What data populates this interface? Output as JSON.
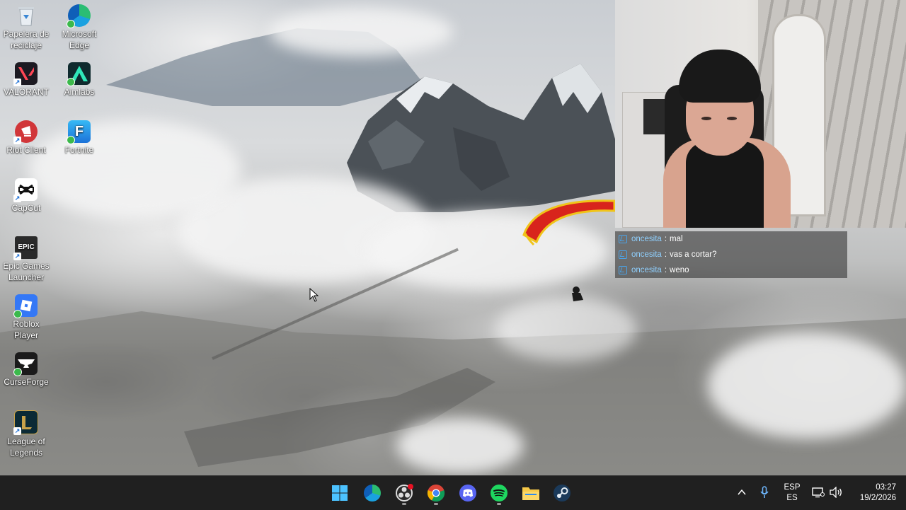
{
  "desktop": {
    "icons": [
      {
        "label": "Papelera de reciclaje",
        "icon": "recycle-bin-icon"
      },
      {
        "label": "Microsoft Edge",
        "icon": "edge-icon"
      },
      {
        "label": "VALORANT",
        "icon": "valorant-icon"
      },
      {
        "label": "Aimlabs",
        "icon": "aimlabs-icon"
      },
      {
        "label": "Riot Client",
        "icon": "riot-client-icon"
      },
      {
        "label": "Fortnite",
        "icon": "fortnite-icon"
      },
      {
        "label": "CapCut",
        "icon": "capcut-icon"
      },
      {
        "label": "Epic Games Launcher",
        "icon": "epic-games-icon",
        "glyph": "EPIC"
      },
      {
        "label": "Roblox Player",
        "icon": "roblox-icon"
      },
      {
        "label": "CurseForge",
        "icon": "curseforge-icon"
      },
      {
        "label": "League of Legends",
        "icon": "league-of-legends-icon"
      }
    ]
  },
  "chat": {
    "messages": [
      {
        "user": "oncesita",
        "separator": ":",
        "text": "mal"
      },
      {
        "user": "oncesita",
        "separator": ":",
        "text": "vas a cortar?"
      },
      {
        "user": "oncesita",
        "separator": ":",
        "text": "weno"
      }
    ]
  },
  "taskbar": {
    "apps": [
      "start-icon",
      "edge-icon",
      "obs-icon",
      "chrome-icon",
      "discord-icon",
      "spotify-icon",
      "file-explorer-icon",
      "steam-icon"
    ],
    "tray": {
      "chevron": "chevron-up-icon",
      "mic": "microphone-icon",
      "language_top": "ESP",
      "language_bottom": "ES",
      "network": "network-icon",
      "volume": "volume-icon",
      "time": "03:27",
      "date": "19/2/2026"
    }
  },
  "colors": {
    "taskbar_bg": "#202020",
    "chat_user": "#8fd0ff",
    "paraglider_red": "#d8241c",
    "paraglider_yellow": "#f0c419"
  }
}
